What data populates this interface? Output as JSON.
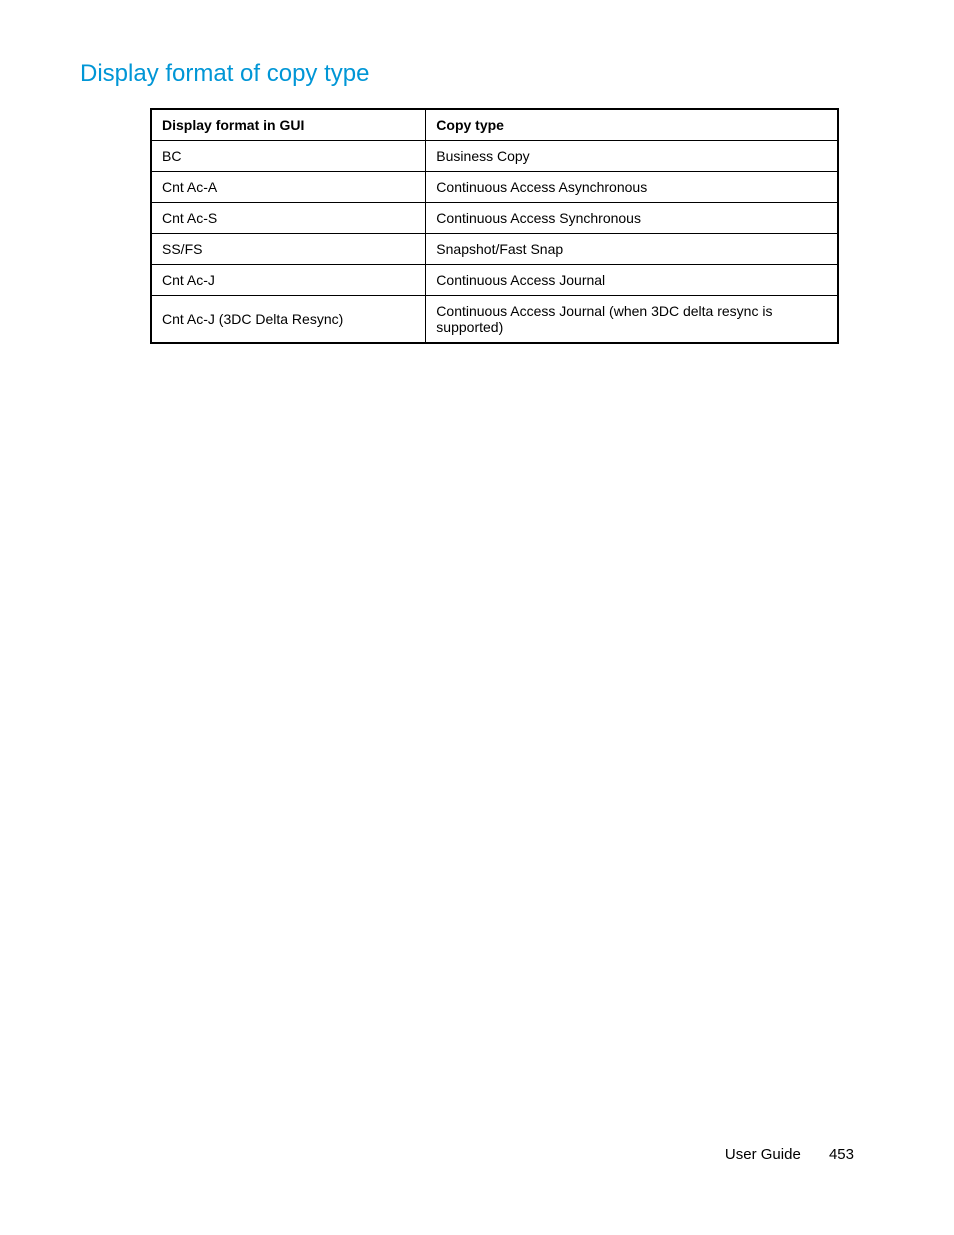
{
  "heading": "Display format of copy type",
  "table": {
    "headers": {
      "col1": "Display format in GUI",
      "col2": "Copy type"
    },
    "rows": [
      {
        "col1": "BC",
        "col2": "Business Copy"
      },
      {
        "col1": "Cnt Ac-A",
        "col2": "Continuous Access Asynchronous"
      },
      {
        "col1": "Cnt Ac-S",
        "col2": "Continuous Access Synchronous"
      },
      {
        "col1": "SS/FS",
        "col2": "Snapshot/Fast Snap"
      },
      {
        "col1": "Cnt Ac-J",
        "col2": "Continuous Access Journal"
      },
      {
        "col1": "Cnt Ac-J (3DC Delta Resync)",
        "col2": "Continuous Access Journal (when 3DC delta resync is supported)"
      }
    ]
  },
  "footer": {
    "label": "User Guide",
    "page": "453"
  }
}
